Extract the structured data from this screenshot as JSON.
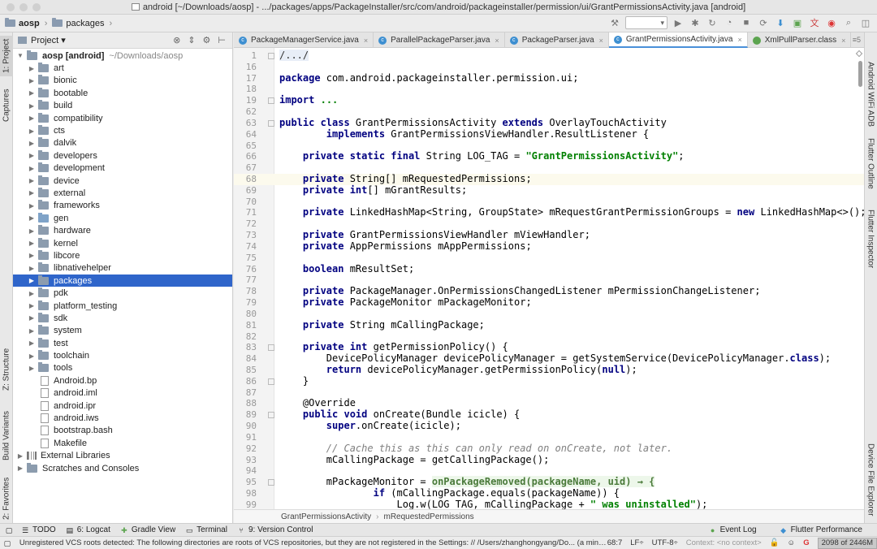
{
  "window": {
    "title": "android [~/Downloads/aosp] - .../packages/apps/PackageInstaller/src/com/android/packageinstaller/permission/ui/GrantPermissionsActivity.java [android]"
  },
  "navbar": {
    "crumbs": [
      "aosp",
      "packages"
    ]
  },
  "left_strip": {
    "tabs": [
      "1: Project",
      "Captures",
      "Z: Structure",
      "Build Variants",
      "2: Favorites"
    ]
  },
  "right_strip": {
    "tabs": [
      "Android WiFi ADB",
      "Flutter Outline",
      "Flutter Inspector",
      "Device File Explorer"
    ]
  },
  "project_panel": {
    "title": "Project",
    "root": "aosp [android]",
    "root_path": "~/Downloads/aosp",
    "folders": [
      "art",
      "bionic",
      "bootable",
      "build",
      "compatibility",
      "cts",
      "dalvik",
      "developers",
      "development",
      "device",
      "external",
      "frameworks",
      "gen",
      "hardware",
      "kernel",
      "libcore",
      "libnativehelper",
      "packages",
      "pdk",
      "platform_testing",
      "sdk",
      "system",
      "test",
      "toolchain",
      "tools"
    ],
    "selected": "packages",
    "files": [
      "Android.bp",
      "android.iml",
      "android.ipr",
      "android.iws",
      "bootstrap.bash",
      "Makefile"
    ],
    "extra": [
      "External Libraries",
      "Scratches and Consoles"
    ]
  },
  "tabs": [
    {
      "label": "PackageManagerService.java",
      "active": false,
      "icon": "java-class-icon"
    },
    {
      "label": "ParallelPackageParser.java",
      "active": false,
      "icon": "java-class-icon"
    },
    {
      "label": "PackageParser.java",
      "active": false,
      "icon": "java-class-icon"
    },
    {
      "label": "GrantPermissionsActivity.java",
      "active": true,
      "icon": "java-class-icon"
    },
    {
      "label": "XmlPullParser.class",
      "active": false,
      "icon": "class-file-icon"
    }
  ],
  "tabs_overflow": "5",
  "editor": {
    "lines": [
      {
        "n": "1",
        "html": "<span class=\"fold-text\">/.../</span>"
      },
      {
        "n": "16",
        "html": ""
      },
      {
        "n": "17",
        "html": "<span class=\"kw\">package</span> com.android.packageinstaller.permission.ui;"
      },
      {
        "n": "18",
        "html": ""
      },
      {
        "n": "19",
        "html": "<span class=\"kw\">import</span> <span class=\"str\">...</span>"
      },
      {
        "n": "62",
        "html": ""
      },
      {
        "n": "63",
        "html": "<span class=\"kw\">public class</span> GrantPermissionsActivity <span class=\"kw\">extends</span> OverlayTouchActivity"
      },
      {
        "n": "64",
        "html": "        <span class=\"kw\">implements</span> GrantPermissionsViewHandler.ResultListener {"
      },
      {
        "n": "65",
        "html": ""
      },
      {
        "n": "66",
        "html": "    <span class=\"kw\">private static final</span> String LOG_TAG = <span class=\"str\">\"GrantPermissionsActivity\"</span>;"
      },
      {
        "n": "67",
        "html": ""
      },
      {
        "n": "68",
        "html": "    <span class=\"kw\">private</span> String[] mRequestedPermissions;",
        "cur": true
      },
      {
        "n": "69",
        "html": "    <span class=\"kw\">private int</span>[] mGrantResults;"
      },
      {
        "n": "70",
        "html": ""
      },
      {
        "n": "71",
        "html": "    <span class=\"kw\">private</span> LinkedHashMap&lt;String, GroupState&gt; mRequestGrantPermissionGroups = <span class=\"kw\">new</span> LinkedHashMap&lt;&gt;();"
      },
      {
        "n": "72",
        "html": ""
      },
      {
        "n": "73",
        "html": "    <span class=\"kw\">private</span> GrantPermissionsViewHandler mViewHandler;"
      },
      {
        "n": "74",
        "html": "    <span class=\"kw\">private</span> AppPermissions mAppPermissions;"
      },
      {
        "n": "75",
        "html": ""
      },
      {
        "n": "76",
        "html": "    <span class=\"kw\">boolean</span> mResultSet;"
      },
      {
        "n": "77",
        "html": ""
      },
      {
        "n": "78",
        "html": "    <span class=\"kw\">private</span> PackageManager.OnPermissionsChangedListener mPermissionChangeListener;"
      },
      {
        "n": "79",
        "html": "    <span class=\"kw\">private</span> PackageMonitor mPackageMonitor;"
      },
      {
        "n": "80",
        "html": ""
      },
      {
        "n": "81",
        "html": "    <span class=\"kw\">private</span> String mCallingPackage;"
      },
      {
        "n": "82",
        "html": ""
      },
      {
        "n": "83",
        "html": "    <span class=\"kw\">private int</span> getPermissionPolicy() {"
      },
      {
        "n": "84",
        "html": "        DevicePolicyManager devicePolicyManager = getSystemService(DevicePolicyManager.<span class=\"kw\">class</span>);"
      },
      {
        "n": "85",
        "html": "        <span class=\"kw\">return</span> devicePolicyManager.getPermissionPolicy(<span class=\"kw\">null</span>);"
      },
      {
        "n": "86",
        "html": "    }"
      },
      {
        "n": "87",
        "html": ""
      },
      {
        "n": "88",
        "html": "    @Override"
      },
      {
        "n": "89",
        "html": "    <span class=\"kw\">public void</span> onCreate(Bundle icicle) {"
      },
      {
        "n": "90",
        "html": "        <span class=\"kw\">super</span>.onCreate(icicle);"
      },
      {
        "n": "91",
        "html": ""
      },
      {
        "n": "92",
        "html": "        <span class=\"cmt\">// Cache this as this can only read on onCreate, not later.</span>"
      },
      {
        "n": "93",
        "html": "        mCallingPackage = getCallingPackage();"
      },
      {
        "n": "94",
        "html": ""
      },
      {
        "n": "95",
        "html": "        mPackageMonitor = <span class=\"lambda\"><b>onPackageRemoved(packageName, uid) → {</b></span>"
      },
      {
        "n": "98",
        "html": "                <span class=\"kw\">if</span> (mCallingPackage.equals(packageName)) {"
      },
      {
        "n": "99",
        "html": "                    Log.w(LOG_TAG, mCallingPackage + <span class=\"str\">\" was uninstalled\"</span>);"
      }
    ]
  },
  "editor_breadcrumb": [
    "GrantPermissionsActivity",
    "mRequestedPermissions"
  ],
  "toolwindows": {
    "left": [
      {
        "label": "TODO"
      },
      {
        "label": "6: Logcat"
      },
      {
        "label": "Gradle View"
      },
      {
        "label": "Terminal"
      },
      {
        "label": "9: Version Control"
      }
    ],
    "right": [
      {
        "label": "Event Log"
      },
      {
        "label": "Flutter Performance"
      }
    ]
  },
  "status": {
    "message": "Unregistered VCS roots detected: The following directories are roots of VCS repositories, but they are not registered in the Settings: // /Users/zhanghongyang/Do... (a minute ago)",
    "position": "68:7",
    "line_sep": "LF÷",
    "encoding": "UTF-8÷",
    "context": "Context: <no context>",
    "memory": "2098 of 2446M"
  },
  "colors": {
    "selection": "#2f65ca",
    "keyword": "#000080",
    "string": "#008000",
    "active_tab_underline": "#4a90d9"
  }
}
